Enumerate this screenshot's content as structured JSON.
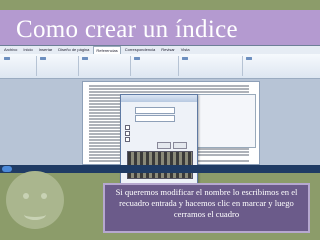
{
  "slide": {
    "title": "Como crear un índice",
    "caption": "Si queremos modificar el nombre lo escribimos en el recuadro entrada y hacemos clic en marcar  y luego cerramos el cuadro"
  },
  "screenshot": {
    "ribbon_tabs": [
      "Archivo",
      "Inicio",
      "Insertar",
      "Diseño de página",
      "Referencias",
      "Correspondencia",
      "Revisar",
      "Vista"
    ],
    "active_tab": "Referencias"
  },
  "colors": {
    "background": "#8c9c6a",
    "title_band": "#b49ad0",
    "caption_box": "#6b5b8a"
  },
  "icons": [
    "smiley-face"
  ]
}
